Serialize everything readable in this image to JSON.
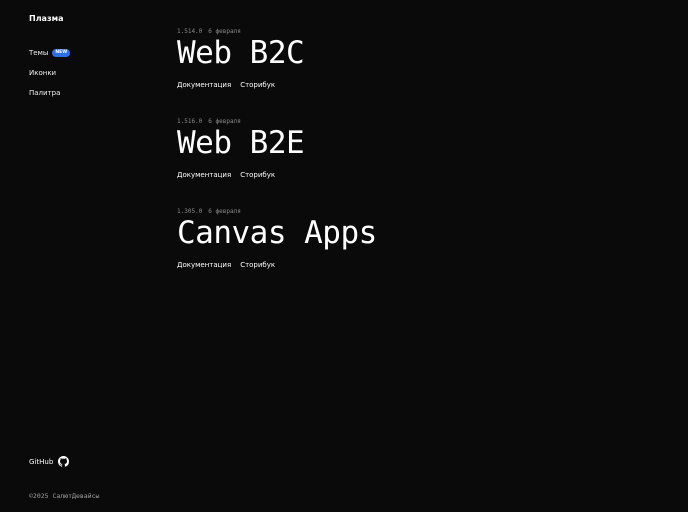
{
  "brand": {
    "logo_text": "Плазма"
  },
  "nav": {
    "items": [
      {
        "label": "Темы",
        "badge": "NEW"
      },
      {
        "label": "Иконки"
      },
      {
        "label": "Палитра"
      }
    ]
  },
  "libraries": [
    {
      "version": "1.514.0",
      "date": "6 февраля",
      "title": "Web B2C",
      "links": [
        "Документация",
        "Сторибук"
      ]
    },
    {
      "version": "1.516.0",
      "date": "6 февраля",
      "title": "Web B2E",
      "links": [
        "Документация",
        "Сторибук"
      ]
    },
    {
      "version": "1.305.0",
      "date": "6 февраля",
      "title": "Canvas Apps",
      "links": [
        "Документация",
        "Сторибук"
      ]
    }
  ],
  "footer": {
    "github_label": "GitHub",
    "github_icon": "github-icon",
    "copyright": "©2025 СалютДевайсы"
  },
  "colors": {
    "background": "#0a0a0a",
    "badge": "#2f6ee9",
    "meta_text": "#8a8a8a"
  }
}
